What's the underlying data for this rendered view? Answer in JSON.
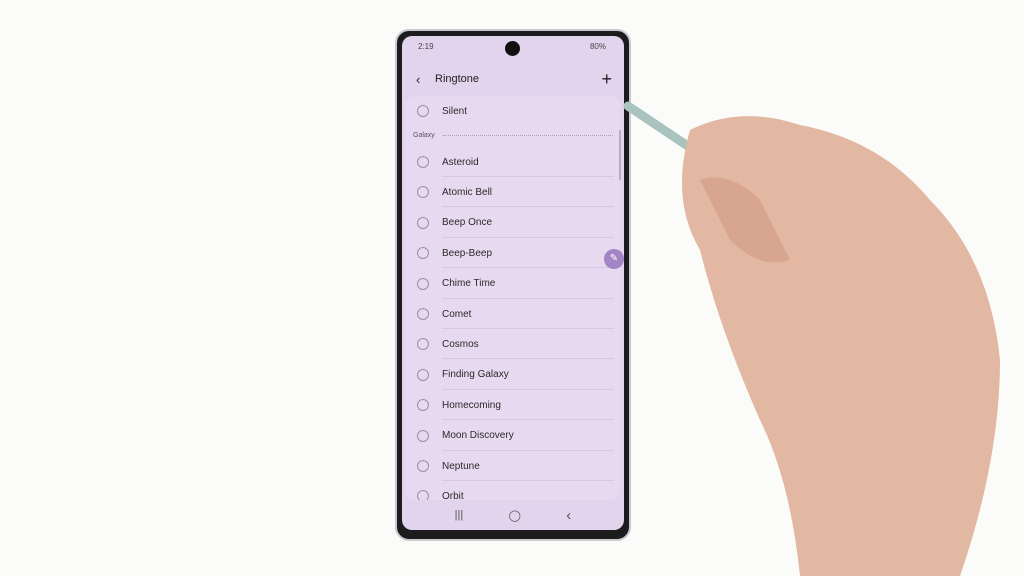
{
  "status_bar": {
    "time": "2:19",
    "battery": "80%"
  },
  "header": {
    "title": "Ringtone",
    "back_icon": "back-chevron-icon",
    "add_icon": "plus-icon"
  },
  "list": {
    "top_item": "Silent",
    "section": "Galaxy",
    "items": [
      "Asteroid",
      "Atomic Bell",
      "Beep Once",
      "Beep-Beep",
      "Chime Time",
      "Comet",
      "Cosmos",
      "Finding Galaxy",
      "Homecoming",
      "Moon Discovery",
      "Neptune",
      "Orbit"
    ]
  },
  "nav": {
    "recents": "|||",
    "home": "◯",
    "back": "‹"
  },
  "colors": {
    "screen": "#e2d4ec",
    "accent": "#a384c4"
  }
}
